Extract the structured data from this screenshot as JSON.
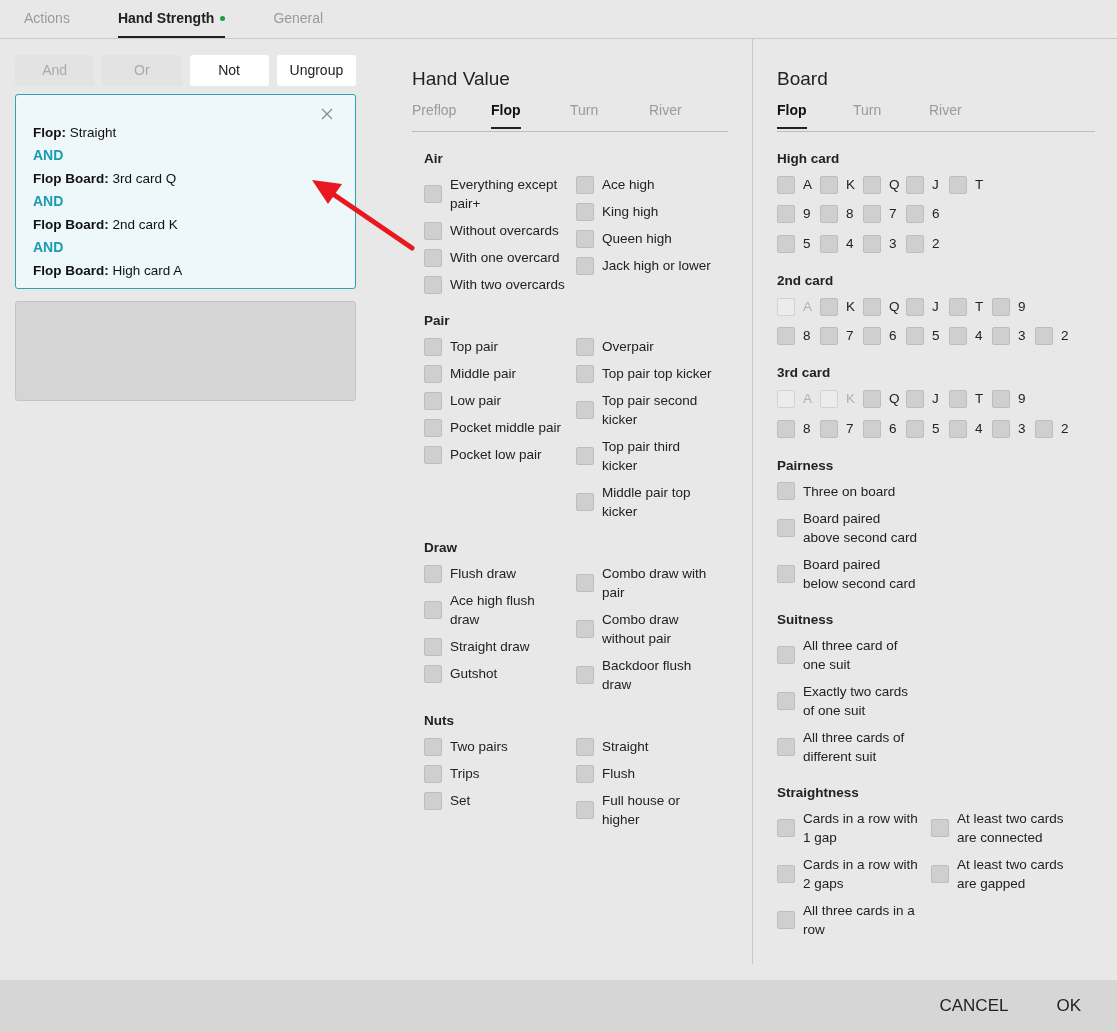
{
  "tabs": [
    {
      "label": "Actions",
      "selected": false,
      "indicator": false
    },
    {
      "label": "Hand Strength",
      "selected": true,
      "indicator": true
    },
    {
      "label": "General",
      "selected": false,
      "indicator": false
    }
  ],
  "toolbar": [
    {
      "label": "And",
      "disabled": true
    },
    {
      "label": "Or",
      "disabled": true
    },
    {
      "label": "Not",
      "disabled": false
    },
    {
      "label": "Ungroup",
      "disabled": false
    }
  ],
  "condition_group": {
    "lines": [
      {
        "kind": "condition",
        "text": "**Flop:** Straight"
      },
      {
        "kind": "operator",
        "text": "AND"
      },
      {
        "kind": "condition",
        "text": "**Flop Board:** 3rd card Q"
      },
      {
        "kind": "operator",
        "text": "AND"
      },
      {
        "kind": "condition",
        "text": "**Flop Board:** 2nd card K"
      },
      {
        "kind": "operator",
        "text": "AND"
      },
      {
        "kind": "condition",
        "text": "**Flop Board:** High card A"
      }
    ]
  },
  "hand_value": {
    "title": "Hand Value",
    "tabs": [
      {
        "label": "Preflop",
        "selected": false
      },
      {
        "label": "Flop",
        "selected": true
      },
      {
        "label": "Turn",
        "selected": false
      },
      {
        "label": "River",
        "selected": false
      }
    ],
    "sections": [
      {
        "title": "Air",
        "columns": [
          [
            {
              "label": "Everything except pair+",
              "checked": false
            },
            {
              "label": "Without overcards",
              "checked": false
            },
            {
              "label": "With one overcard",
              "checked": false
            },
            {
              "label": "With two overcards",
              "checked": false
            }
          ],
          [
            {
              "label": "Ace high",
              "checked": false
            },
            {
              "label": "King high",
              "checked": false
            },
            {
              "label": "Queen high",
              "checked": false
            },
            {
              "label": "Jack high or lower",
              "checked": false
            }
          ]
        ]
      },
      {
        "title": "Pair",
        "columns": [
          [
            {
              "label": "Top pair",
              "checked": false
            },
            {
              "label": "Middle pair",
              "checked": false
            },
            {
              "label": "Low pair",
              "checked": false
            },
            {
              "label": "Pocket middle pair",
              "checked": false
            },
            {
              "label": "Pocket low pair",
              "checked": false
            }
          ],
          [
            {
              "label": "Overpair",
              "checked": false
            },
            {
              "label": "Top pair top kicker",
              "checked": false
            },
            {
              "label": "Top pair second kicker",
              "checked": false
            },
            {
              "label": "Top pair third kicker",
              "checked": false
            },
            {
              "label": "Middle pair top kicker",
              "checked": false
            }
          ]
        ]
      },
      {
        "title": "Draw",
        "columns": [
          [
            {
              "label": "Flush draw",
              "checked": false
            },
            {
              "label": "Ace high flush draw",
              "checked": false
            },
            {
              "label": "Straight draw",
              "checked": false
            },
            {
              "label": "Gutshot",
              "checked": false
            }
          ],
          [
            {
              "label": "Combo draw with pair",
              "checked": false
            },
            {
              "label": "Combo draw without pair",
              "checked": false
            },
            {
              "label": "Backdoor flush draw",
              "checked": false
            }
          ]
        ]
      },
      {
        "title": "Nuts",
        "columns": [
          [
            {
              "label": "Two pairs",
              "checked": false
            },
            {
              "label": "Trips",
              "checked": false
            },
            {
              "label": "Set",
              "checked": false
            }
          ],
          [
            {
              "label": "Straight",
              "checked": false
            },
            {
              "label": "Flush",
              "checked": false
            },
            {
              "label": "Full house or higher",
              "checked": false
            }
          ]
        ]
      }
    ]
  },
  "board": {
    "title": "Board",
    "tabs": [
      {
        "label": "Flop",
        "selected": true
      },
      {
        "label": "Turn",
        "selected": false
      },
      {
        "label": "River",
        "selected": false
      }
    ],
    "sections": [
      {
        "kind": "cards",
        "title": "High card",
        "rows": [
          [
            {
              "label": "A",
              "checked": false,
              "disabled": false
            },
            {
              "label": "K",
              "checked": false,
              "disabled": false
            },
            {
              "label": "Q",
              "checked": false,
              "disabled": false
            },
            {
              "label": "J",
              "checked": false,
              "disabled": false
            },
            {
              "label": "T",
              "checked": false,
              "disabled": false
            }
          ],
          [
            {
              "label": "9",
              "checked": false,
              "disabled": false
            },
            {
              "label": "8",
              "checked": false,
              "disabled": false
            },
            {
              "label": "7",
              "checked": false,
              "disabled": false
            },
            {
              "label": "6",
              "checked": false,
              "disabled": false
            }
          ],
          [
            {
              "label": "5",
              "checked": false,
              "disabled": false
            },
            {
              "label": "4",
              "checked": false,
              "disabled": false
            },
            {
              "label": "3",
              "checked": false,
              "disabled": false
            },
            {
              "label": "2",
              "checked": false,
              "disabled": false
            }
          ]
        ]
      },
      {
        "kind": "cards",
        "title": "2nd card",
        "rows": [
          [
            {
              "label": "A",
              "checked": false,
              "disabled": true
            },
            {
              "label": "K",
              "checked": false,
              "disabled": false
            },
            {
              "label": "Q",
              "checked": false,
              "disabled": false
            },
            {
              "label": "J",
              "checked": false,
              "disabled": false
            },
            {
              "label": "T",
              "checked": false,
              "disabled": false
            },
            {
              "label": "9",
              "checked": false,
              "disabled": false
            }
          ],
          [
            {
              "label": "8",
              "checked": false,
              "disabled": false
            },
            {
              "label": "7",
              "checked": false,
              "disabled": false
            },
            {
              "label": "6",
              "checked": false,
              "disabled": false
            },
            {
              "label": "5",
              "checked": false,
              "disabled": false
            },
            {
              "label": "4",
              "checked": false,
              "disabled": false
            },
            {
              "label": "3",
              "checked": false,
              "disabled": false
            },
            {
              "label": "2",
              "checked": false,
              "disabled": false
            }
          ]
        ]
      },
      {
        "kind": "cards",
        "title": "3rd card",
        "rows": [
          [
            {
              "label": "A",
              "checked": false,
              "disabled": true
            },
            {
              "label": "K",
              "checked": false,
              "disabled": true
            },
            {
              "label": "Q",
              "checked": false,
              "disabled": false
            },
            {
              "label": "J",
              "checked": false,
              "disabled": false
            },
            {
              "label": "T",
              "checked": false,
              "disabled": false
            },
            {
              "label": "9",
              "checked": false,
              "disabled": false
            }
          ],
          [
            {
              "label": "8",
              "checked": false,
              "disabled": false
            },
            {
              "label": "7",
              "checked": false,
              "disabled": false
            },
            {
              "label": "6",
              "checked": false,
              "disabled": false
            },
            {
              "label": "5",
              "checked": false,
              "disabled": false
            },
            {
              "label": "4",
              "checked": false,
              "disabled": false
            },
            {
              "label": "3",
              "checked": false,
              "disabled": false
            },
            {
              "label": "2",
              "checked": false,
              "disabled": false
            }
          ]
        ]
      },
      {
        "kind": "options",
        "title": "Pairness",
        "columns": [
          [
            {
              "label": "Three on board",
              "checked": false
            },
            {
              "label": "Board paired above second card",
              "checked": false
            },
            {
              "label": "Board paired below second card",
              "checked": false
            }
          ]
        ]
      },
      {
        "kind": "options",
        "title": "Suitness",
        "columns": [
          [
            {
              "label": "All three card of one suit",
              "checked": false
            },
            {
              "label": "Exactly two cards of one suit",
              "checked": false
            },
            {
              "label": "All three cards of different suit",
              "checked": false
            }
          ]
        ]
      },
      {
        "kind": "options",
        "title": "Straightness",
        "columns": [
          [
            {
              "label": "Cards in a row with 1 gap",
              "checked": false
            },
            {
              "label": "Cards in a row with 2 gaps",
              "checked": false
            },
            {
              "label": "All three cards in a row",
              "checked": false
            }
          ],
          [
            {
              "label": "At least two cards are connected",
              "checked": false
            },
            {
              "label": "At least two cards are gapped",
              "checked": false
            }
          ]
        ]
      }
    ]
  },
  "footer": [
    {
      "label": "CANCEL"
    },
    {
      "label": "OK"
    }
  ]
}
